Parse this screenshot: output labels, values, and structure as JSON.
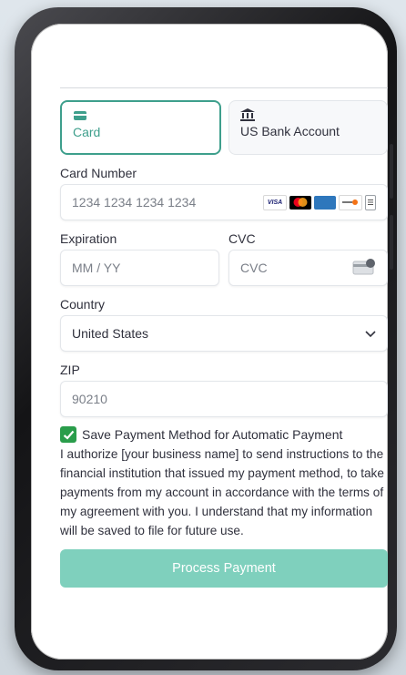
{
  "tabs": {
    "card_label": "Card",
    "bank_label": "US Bank Account"
  },
  "card_number": {
    "label": "Card Number",
    "placeholder": "1234 1234 1234 1234",
    "brands": [
      "VISA",
      "",
      "",
      ""
    ]
  },
  "expiration": {
    "label": "Expiration",
    "placeholder": "MM / YY"
  },
  "cvc": {
    "label": "CVC",
    "placeholder": "CVC"
  },
  "country": {
    "label": "Country",
    "value": "United States"
  },
  "zip": {
    "label": "ZIP",
    "placeholder": "90210"
  },
  "save_payment": {
    "label": "Save Payment Method for Automatic Payment",
    "checked": true
  },
  "authorization_text": "I authorize [your business name] to send instructions to the financial institution that issued my payment method, to take payments from my account in accordance with the terms of my agreement with you. I understand that my information will be saved to file for future use.",
  "submit_label": "Process Payment",
  "colors": {
    "accent": "#3e9f8c",
    "button": "#7fd0bd",
    "check": "#2a9d4b"
  }
}
